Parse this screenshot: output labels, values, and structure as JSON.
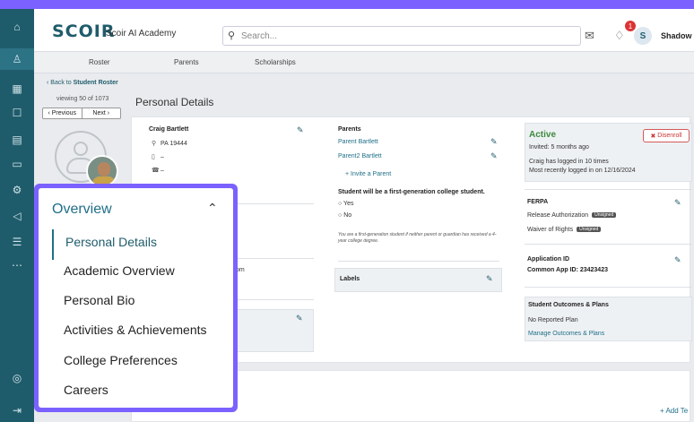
{
  "app": {
    "brand": "SCOIR",
    "org": "Scoir AI Academy",
    "search_placeholder": "Search...",
    "notifications_count": "1",
    "user_initial": "S",
    "user_name": "Shadow ⌄",
    "accent_color": "#7b61ff",
    "nav_color": "#1f5c6b"
  },
  "leftnav": [
    {
      "icon": "home-icon",
      "glyph": "⌂"
    },
    {
      "icon": "students-icon",
      "glyph": "♙"
    },
    {
      "icon": "school-icon",
      "glyph": "▦"
    },
    {
      "icon": "document-icon",
      "glyph": "☐"
    },
    {
      "icon": "calendar-icon",
      "glyph": "▤"
    },
    {
      "icon": "folder-icon",
      "glyph": "▭"
    },
    {
      "icon": "settings-icon",
      "glyph": "⚙"
    },
    {
      "icon": "megaphone-icon",
      "glyph": "◁"
    },
    {
      "icon": "list-icon",
      "glyph": "☰"
    },
    {
      "icon": "more-icon",
      "glyph": "⋯"
    },
    {
      "icon": "compass-icon",
      "glyph": "◎"
    },
    {
      "icon": "expand-icon",
      "glyph": "⇥"
    }
  ],
  "subnav": [
    "Roster",
    "Parents",
    "Scholarships"
  ],
  "roster_nav": {
    "back_prefix": "‹ Back to ",
    "back_link": "Student Roster",
    "viewing": "viewing 50 of 1073",
    "prev": "‹ Previous",
    "next": "Next ›"
  },
  "page_title": "Personal Details",
  "student": {
    "name": "Craig Bartlett",
    "location": "PA 19444",
    "phone1": "–",
    "phone2": "–",
    "email_fragment": "om"
  },
  "parents": {
    "title": "Parents",
    "list": [
      "Parent Bartlett",
      "Parent2 Bartlett"
    ],
    "invite": "+ Invite a Parent",
    "first_gen_question": "Student will be a first-generation college student.",
    "options": [
      "Yes",
      "No"
    ],
    "fine_print": "You are a first-generation student if neither parent or guardian has received a 4-year college degree."
  },
  "labels_title": "Labels",
  "status": {
    "state": "Active",
    "disenroll": "Disenroll",
    "invited": "Invited: 5 months ago",
    "logins": "Craig has logged in 10 times",
    "last_login": "Most recently logged in on 12/16/2024"
  },
  "ferpa": {
    "title": "FERPA",
    "rows": [
      "Release Authorization",
      "Waiver of Rights"
    ],
    "badge": "Unsigned"
  },
  "application": {
    "title": "Application ID",
    "common_app": "Common App ID: 23423423"
  },
  "outcomes": {
    "title": "Student Outcomes & Plans",
    "none": "No Reported Plan",
    "manage": "Manage Outcomes & Plans"
  },
  "bottom": {
    "add_label": "+ Add Te"
  },
  "overview_menu": {
    "title": "Overview",
    "items": [
      "Personal Details",
      "Academic Overview",
      "Personal Bio",
      "Activities & Achievements",
      "College Preferences",
      "Careers"
    ],
    "selected_index": 0
  }
}
